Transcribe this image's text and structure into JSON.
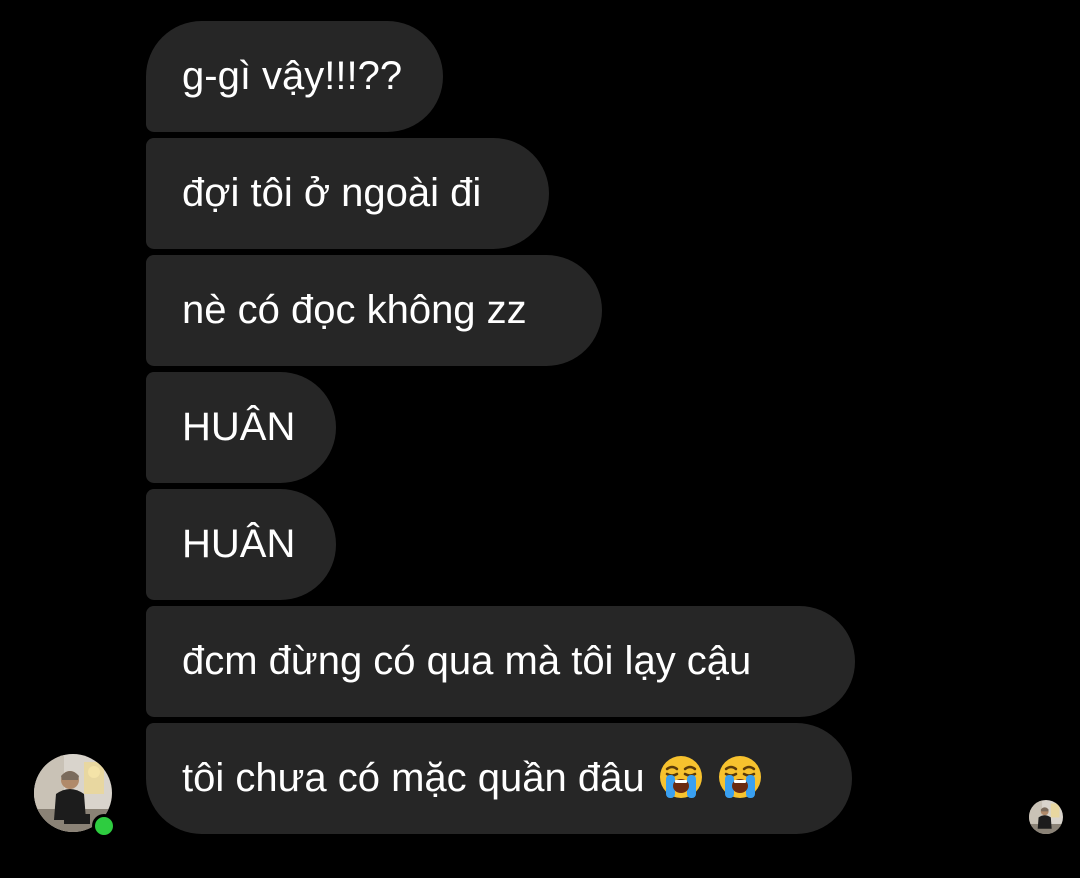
{
  "messages": [
    {
      "text": "g-gì vậy!!!??"
    },
    {
      "text": "đợi tôi ở ngoài đi"
    },
    {
      "text": "nè có đọc không zz"
    },
    {
      "text": "HUÂN"
    },
    {
      "text": "HUÂN"
    },
    {
      "text": "đcm đừng có qua mà tôi lạy cậu"
    },
    {
      "text": "tôi chưa có mặc quần đâu",
      "emojis": [
        "loudly-crying-face",
        "loudly-crying-face"
      ]
    }
  ],
  "sender": {
    "avatar_icon": "profile-photo",
    "status": "online",
    "status_color": "#2ecc40"
  },
  "seen_indicator": {
    "avatar_icon": "profile-photo"
  },
  "colors": {
    "background": "#000000",
    "bubble": "#262626",
    "text": "#ffffff"
  }
}
